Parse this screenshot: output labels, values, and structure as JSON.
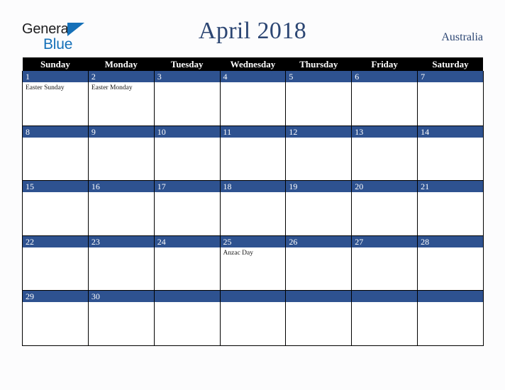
{
  "brand": {
    "word_one": "General",
    "word_two": "Blue",
    "triangle_icon": "triangle-icon",
    "accent_blue": "#1570b8",
    "text_dark": "#1d1d1f"
  },
  "header": {
    "title": "April 2018",
    "country": "Australia",
    "title_color": "#2c4673"
  },
  "colors": {
    "header_row_bg": "#000000",
    "header_row_text": "#ffffff",
    "day_bar_bg": "#2e5290",
    "day_bar_text": "#ffffff",
    "cell_bg": "#ffffff",
    "grid_line": "#000000",
    "page_bg": "#fcfcfd"
  },
  "calendar": {
    "month": "April",
    "year": "2018",
    "weekday_headers": [
      "Sunday",
      "Monday",
      "Tuesday",
      "Wednesday",
      "Thursday",
      "Friday",
      "Saturday"
    ],
    "weeks": [
      [
        {
          "day": "1",
          "events": [
            "Easter Sunday"
          ]
        },
        {
          "day": "2",
          "events": [
            "Easter Monday"
          ]
        },
        {
          "day": "3",
          "events": []
        },
        {
          "day": "4",
          "events": []
        },
        {
          "day": "5",
          "events": []
        },
        {
          "day": "6",
          "events": []
        },
        {
          "day": "7",
          "events": []
        }
      ],
      [
        {
          "day": "8",
          "events": []
        },
        {
          "day": "9",
          "events": []
        },
        {
          "day": "10",
          "events": []
        },
        {
          "day": "11",
          "events": []
        },
        {
          "day": "12",
          "events": []
        },
        {
          "day": "13",
          "events": []
        },
        {
          "day": "14",
          "events": []
        }
      ],
      [
        {
          "day": "15",
          "events": []
        },
        {
          "day": "16",
          "events": []
        },
        {
          "day": "17",
          "events": []
        },
        {
          "day": "18",
          "events": []
        },
        {
          "day": "19",
          "events": []
        },
        {
          "day": "20",
          "events": []
        },
        {
          "day": "21",
          "events": []
        }
      ],
      [
        {
          "day": "22",
          "events": []
        },
        {
          "day": "23",
          "events": []
        },
        {
          "day": "24",
          "events": []
        },
        {
          "day": "25",
          "events": [
            "Anzac Day"
          ]
        },
        {
          "day": "26",
          "events": []
        },
        {
          "day": "27",
          "events": []
        },
        {
          "day": "28",
          "events": []
        }
      ],
      [
        {
          "day": "29",
          "events": []
        },
        {
          "day": "30",
          "events": []
        },
        {
          "day": "",
          "events": []
        },
        {
          "day": "",
          "events": []
        },
        {
          "day": "",
          "events": []
        },
        {
          "day": "",
          "events": []
        },
        {
          "day": "",
          "events": []
        }
      ]
    ]
  }
}
